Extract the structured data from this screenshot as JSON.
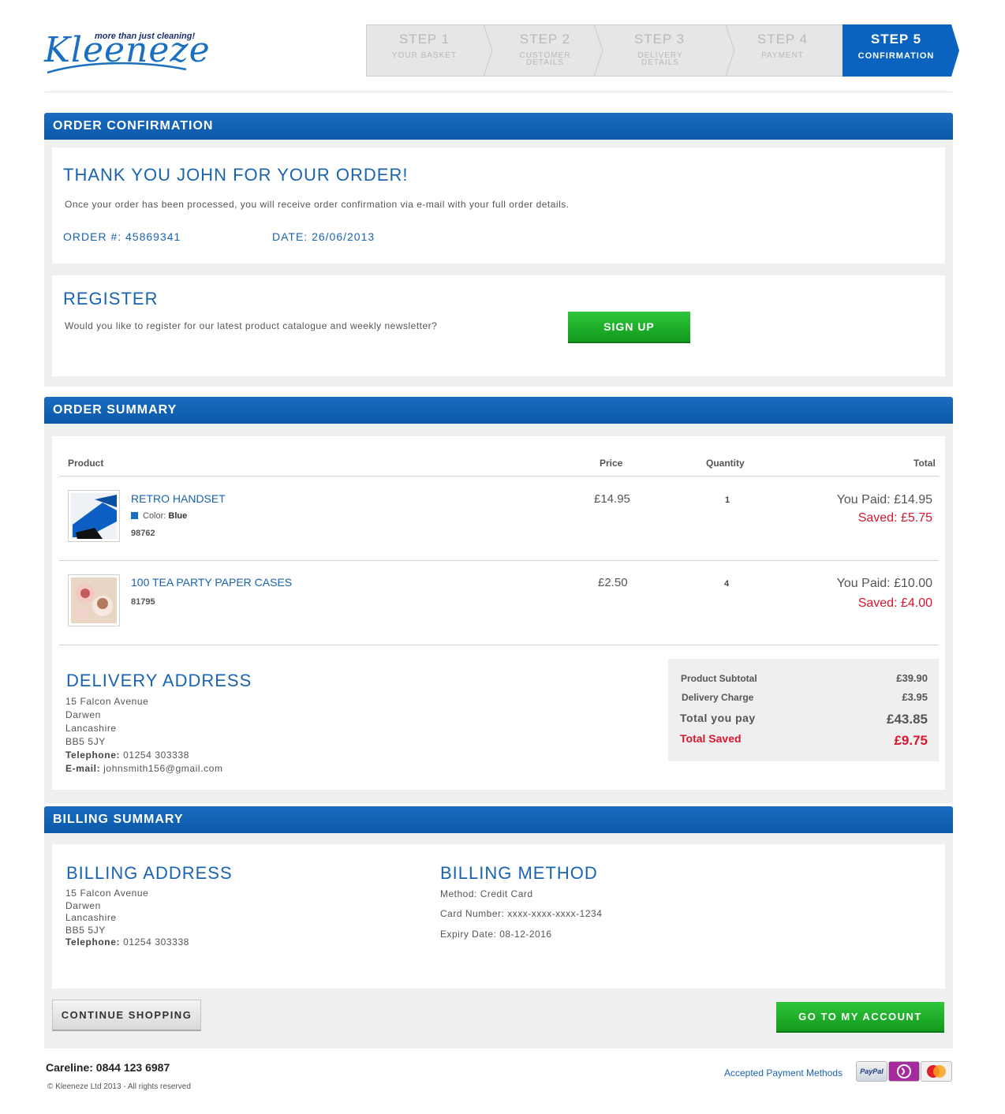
{
  "brand": {
    "tagline": "more than just cleaning!",
    "name": "Kleeneze"
  },
  "steps": [
    {
      "num": "STEP 1",
      "label": "YOUR BASKET"
    },
    {
      "num": "STEP 2",
      "label": "CUSTOMER DETAILS"
    },
    {
      "num": "STEP 3",
      "label": "DELIVERY DETAILS"
    },
    {
      "num": "STEP 4",
      "label": "PAYMENT"
    },
    {
      "num": "STEP 5",
      "label": "CONFIRMATION"
    }
  ],
  "confirmation": {
    "section_title": "ORDER CONFIRMATION",
    "heading": "THANK YOU JOHN FOR YOUR ORDER!",
    "message": "Once your order has been processed, you will receive order confirmation via e-mail with your full order details.",
    "order_no": "ORDER #: 45869341",
    "date": "DATE: 26/06/2013"
  },
  "register": {
    "heading": "REGISTER",
    "text": "Would you like to register for our latest product catalogue and weekly newsletter?",
    "button": "SIGN UP"
  },
  "summary": {
    "section_title": "ORDER SUMMARY",
    "columns": {
      "product": "Product",
      "price": "Price",
      "quantity": "Quantity",
      "total": "Total"
    },
    "items": [
      {
        "name": "RETRO HANDSET",
        "color_label": "Color:",
        "color_value": "Blue",
        "swatch": "#1a6fc0",
        "code": "98762",
        "price": "£14.95",
        "quantity": "1",
        "paid": "You Paid: £14.95",
        "saved": "Saved: £5.75"
      },
      {
        "name": "100 TEA PARTY PAPER CASES",
        "code": "81795",
        "price": "£2.50",
        "quantity": "4",
        "paid": "You Paid: £10.00",
        "saved": "Saved: £4.00"
      }
    ],
    "delivery": {
      "heading": "DELIVERY ADDRESS",
      "line1": "15 Falcon Avenue",
      "line2": "Darwen",
      "line3": "Lancashire",
      "line4": "BB5 5JY",
      "tel_label": "Telephone:",
      "tel": "01254 303338",
      "email_label": "E-mail:",
      "email": "johnsmith156@gmail.com"
    },
    "totals": {
      "subtotal_label": "Product Subtotal",
      "subtotal": "£39.90",
      "delivery_label": "Delivery Charge",
      "delivery": "£3.95",
      "pay_label": "Total you pay",
      "pay": "£43.85",
      "saved_label": "Total Saved",
      "saved": "£9.75"
    }
  },
  "billing": {
    "section_title": "BILLING SUMMARY",
    "address_heading": "BILLING ADDRESS",
    "line1": "15 Falcon Avenue",
    "line2": "Darwen",
    "line3": "Lancashire",
    "line4": "BB5 5JY",
    "tel_label": "Telephone:",
    "tel": "01254 303338",
    "method_heading": "BILLING METHOD",
    "method": "Method: Credit Card",
    "card": "Card Number: xxxx-xxxx-xxxx-1234",
    "expiry": "Expiry Date: 08-12-2016"
  },
  "actions": {
    "continue": "CONTINUE SHOPPING",
    "account": "GO TO MY ACCOUNT"
  },
  "footer": {
    "careline": "Careline: 0844 123 6987",
    "copyright": "© Kleeneze Ltd 2013 - All rights reserved",
    "payments_label": "Accepted Payment Methods",
    "payment_icons": [
      "paypal-icon",
      "solo-icon",
      "mastercard-icon"
    ],
    "paypal_text": "PayPal"
  },
  "colors": {
    "brand_blue": "#1a63b0",
    "button_green": "#1faa2a",
    "saved_red": "#d6172f"
  }
}
